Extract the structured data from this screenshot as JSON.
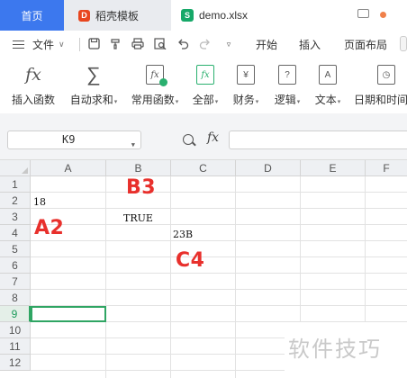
{
  "tabs": {
    "home": "首页",
    "docer": "稻壳模板",
    "docer_icon": "D",
    "file": "demo.xlsx",
    "file_icon": "S"
  },
  "menu": {
    "file": "文件",
    "items": [
      "开始",
      "插入",
      "页面布局"
    ]
  },
  "ribbon": [
    {
      "label": "插入函数",
      "icon": "fx-icon",
      "glyph": "fx",
      "caret": false
    },
    {
      "label": "自动求和",
      "icon": "sum-icon",
      "glyph": "∑",
      "caret": true
    },
    {
      "label": "常用函数",
      "icon": "common-function-icon",
      "glyph": "fx",
      "caret": true
    },
    {
      "label": "全部",
      "icon": "all-function-icon",
      "glyph": "fx",
      "caret": true
    },
    {
      "label": "财务",
      "icon": "finance-icon",
      "glyph": "¥",
      "caret": true
    },
    {
      "label": "逻辑",
      "icon": "logic-icon",
      "glyph": "?",
      "caret": true
    },
    {
      "label": "文本",
      "icon": "text-icon",
      "glyph": "A",
      "caret": true
    },
    {
      "label": "日期和时间",
      "icon": "datetime-icon",
      "glyph": "◷",
      "caret": false
    }
  ],
  "formula_bar": {
    "name_box": "K9",
    "fx": "fx",
    "value": ""
  },
  "columns": [
    "A",
    "B",
    "C",
    "D",
    "E",
    "F"
  ],
  "rows": [
    "1",
    "2",
    "3",
    "4",
    "5",
    "6",
    "7",
    "8",
    "9",
    "10",
    "11",
    "12"
  ],
  "active_row": "9",
  "cells": {
    "A2": "18",
    "B3": "TRUE",
    "C4": "23B"
  },
  "annotations": {
    "b3": "B3",
    "a2": "A2",
    "c4": "C4"
  },
  "watermark": "软件技巧",
  "colors": {
    "accent": "#3c78ee",
    "selection": "#2fa563",
    "annotation": "#e8302c"
  }
}
